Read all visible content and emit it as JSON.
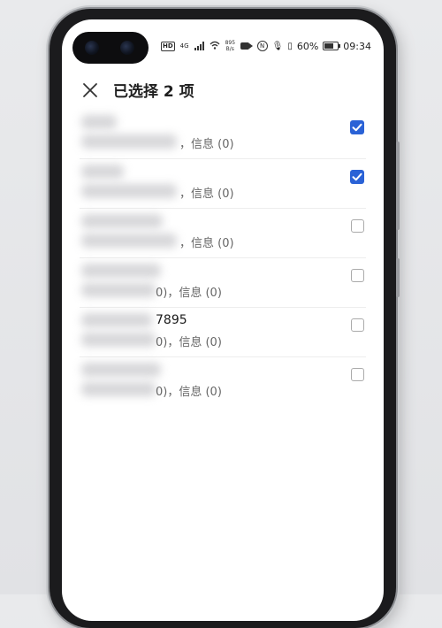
{
  "header": {
    "title": "已选择 2 项"
  },
  "status_bar": {
    "left": {
      "hd": "HD",
      "network": "4G",
      "speed_top": "895",
      "speed_bottom": "B/s"
    },
    "right": {
      "battery": "60%",
      "time": "09:34"
    }
  },
  "contacts": [
    {
      "title_visible": "",
      "subtitle_visible": "，信息 (0)",
      "checked": true
    },
    {
      "title_visible": "",
      "subtitle_visible": "，信息 (0)",
      "checked": true
    },
    {
      "title_visible": "",
      "subtitle_visible": "，信息 (0)",
      "checked": false
    },
    {
      "title_visible": "",
      "subtitle_visible": "0)，信息 (0)",
      "checked": false
    },
    {
      "title_visible": "7895",
      "subtitle_visible": "0)，信息 (0)",
      "checked": false
    },
    {
      "title_visible": "",
      "subtitle_visible": "0)，信息 (0)",
      "checked": false
    }
  ],
  "colors": {
    "accent": "#2a62d6",
    "text": "#1a1a1a",
    "subtext": "#666666"
  },
  "icons": {
    "close": "close-icon",
    "check": "checkmark-icon"
  }
}
